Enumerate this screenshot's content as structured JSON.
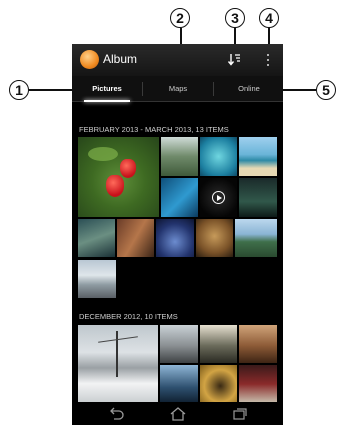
{
  "app": {
    "title": "Album",
    "icon": "album-icon"
  },
  "actions": {
    "sort_icon": "sort-icon",
    "overflow_icon": "overflow-menu-icon"
  },
  "tabs": [
    {
      "label": "Pictures",
      "active": true
    },
    {
      "label": "Maps",
      "active": false
    },
    {
      "label": "Online",
      "active": false
    }
  ],
  "sections": [
    {
      "heading": "FEBRUARY 2013 - MARCH 2013, 13 ITEMS"
    },
    {
      "heading": "DECEMBER 2012, 10 ITEMS"
    }
  ],
  "callouts": [
    "1",
    "2",
    "3",
    "4",
    "5"
  ],
  "navbar": {
    "icons": [
      "back-icon",
      "home-icon",
      "recent-apps-icon"
    ]
  }
}
